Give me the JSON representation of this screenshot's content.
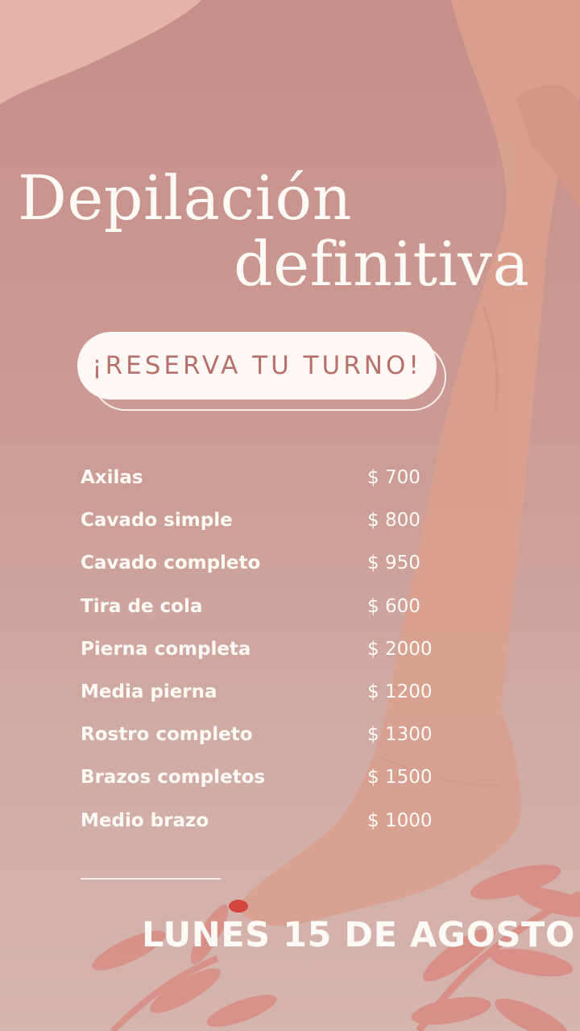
{
  "header": {
    "title_line1": "Depilación",
    "title_line2": "definitiva"
  },
  "cta": {
    "label": "¡RESERVA TU TURNO!"
  },
  "price_list": [
    {
      "name": "Axilas",
      "price": "$ 700"
    },
    {
      "name": "Cavado simple",
      "price": "$ 800"
    },
    {
      "name": "Cavado completo",
      "price": "$ 950"
    },
    {
      "name": "Tira de cola",
      "price": "$ 600"
    },
    {
      "name": "Pierna completa",
      "price": "$ 2000"
    },
    {
      "name": "Media pierna",
      "price": "$ 1200"
    },
    {
      "name": "Rostro completo",
      "price": "$ 1300"
    },
    {
      "name": "Brazos completos",
      "price": "$ 1500"
    },
    {
      "name": "Medio brazo",
      "price": "$ 1000"
    }
  ],
  "footer": {
    "date": "LUNES 15 DE AGOSTO"
  },
  "colors": {
    "background": "#c99891",
    "accent": "#b7716d",
    "text": "#fffaf6",
    "nail": "#d4453c"
  },
  "icons": [
    "leaf-branch-icon"
  ]
}
